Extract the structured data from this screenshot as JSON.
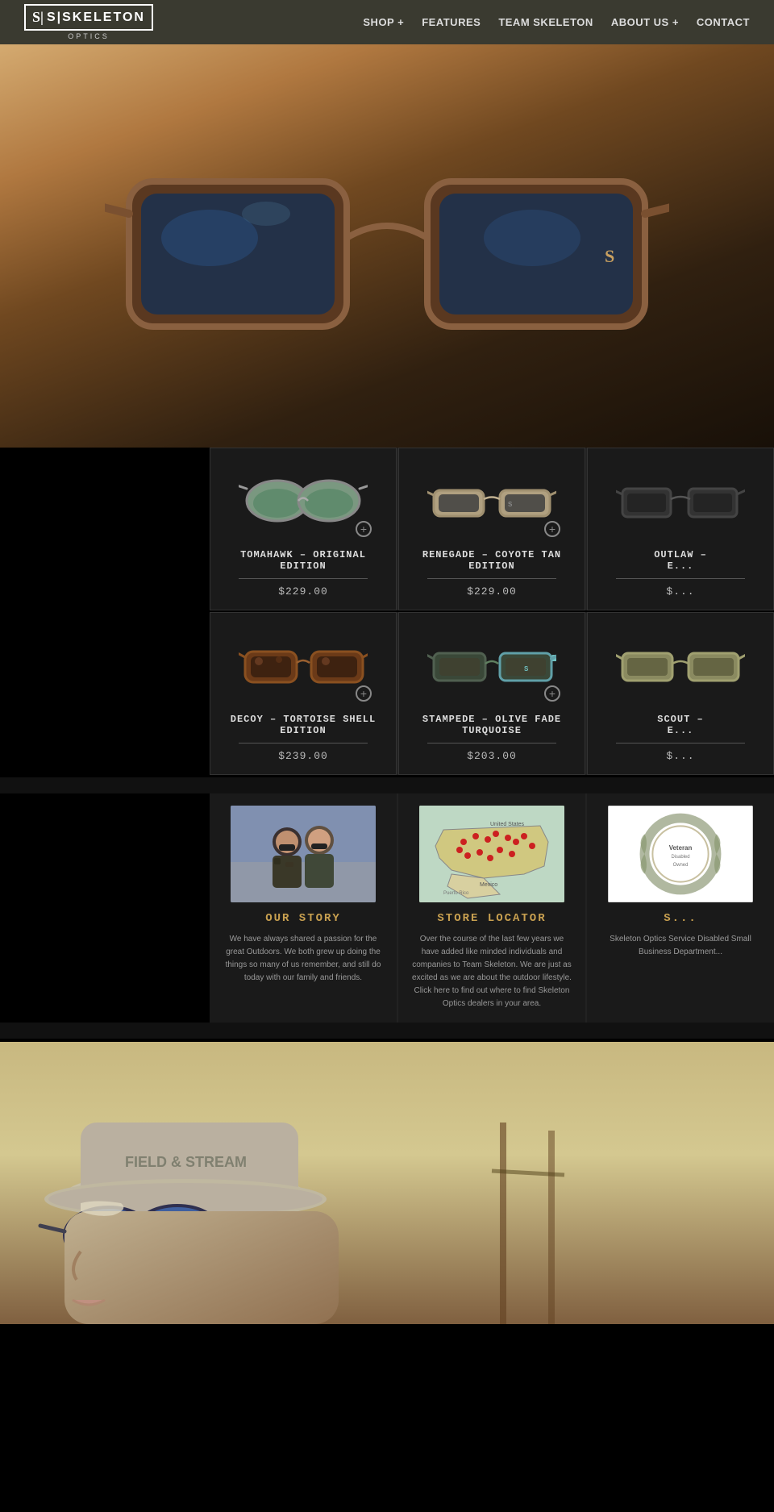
{
  "header": {
    "logo_top": "S|SKELETON",
    "logo_sub": "OPTICS",
    "nav": [
      {
        "label": "SHOP +",
        "id": "shop"
      },
      {
        "label": "FEATURES",
        "id": "features"
      },
      {
        "label": "TEAM SKELETON",
        "id": "team"
      },
      {
        "label": "ABOUT US +",
        "id": "about"
      },
      {
        "label": "CONTACT",
        "id": "contact"
      }
    ]
  },
  "products": {
    "row1": [
      {
        "id": "tomahawk",
        "name": "TOMAHAWK –\nORIGINAL EDITION",
        "price": "$229.00",
        "lens_color": "#6a9080",
        "frame_color": "#888"
      },
      {
        "id": "renegade",
        "name": "RENEGADE – COYOTE\nTAN EDITION",
        "price": "$229.00",
        "lens_color": "#505050",
        "frame_color": "#b0a080"
      },
      {
        "id": "outlaw",
        "name": "OUTLAW –\nE...",
        "price": "$...",
        "lens_color": "#404040",
        "frame_color": "#333"
      }
    ],
    "row2": [
      {
        "id": "decoy",
        "name": "DECOY – TORTOISE\nSHELL EDITION",
        "price": "$239.00",
        "lens_color": "#504030",
        "frame_color": "#704828"
      },
      {
        "id": "stampede",
        "name": "STAMPEDE – OLIVE\nFADE TURQUOISE",
        "price": "$203.00",
        "lens_color": "#506050",
        "frame_color": "#405848"
      },
      {
        "id": "scout",
        "name": "SCOUT –\nE...",
        "price": "$...",
        "lens_color": "#808060",
        "frame_color": "#a0a070"
      }
    ]
  },
  "info": {
    "our_story": {
      "title": "OUR STORY",
      "text": "We have always shared a passion for the great Outdoors. We both grew up doing the things so many of us remember, and still do today with our family and friends."
    },
    "store_locator": {
      "title": "STORE LOCATOR",
      "text": "Over the course of the last few years we have added like minded individuals and companies to Team Skeleton. We are just as excited as we are about the outdoor lifestyle. Click here to find out where to find Skeleton Optics dealers in your area."
    },
    "award": {
      "title": "S...",
      "text": "Skeleton Optics Service Disabled Small Business Department..."
    }
  }
}
